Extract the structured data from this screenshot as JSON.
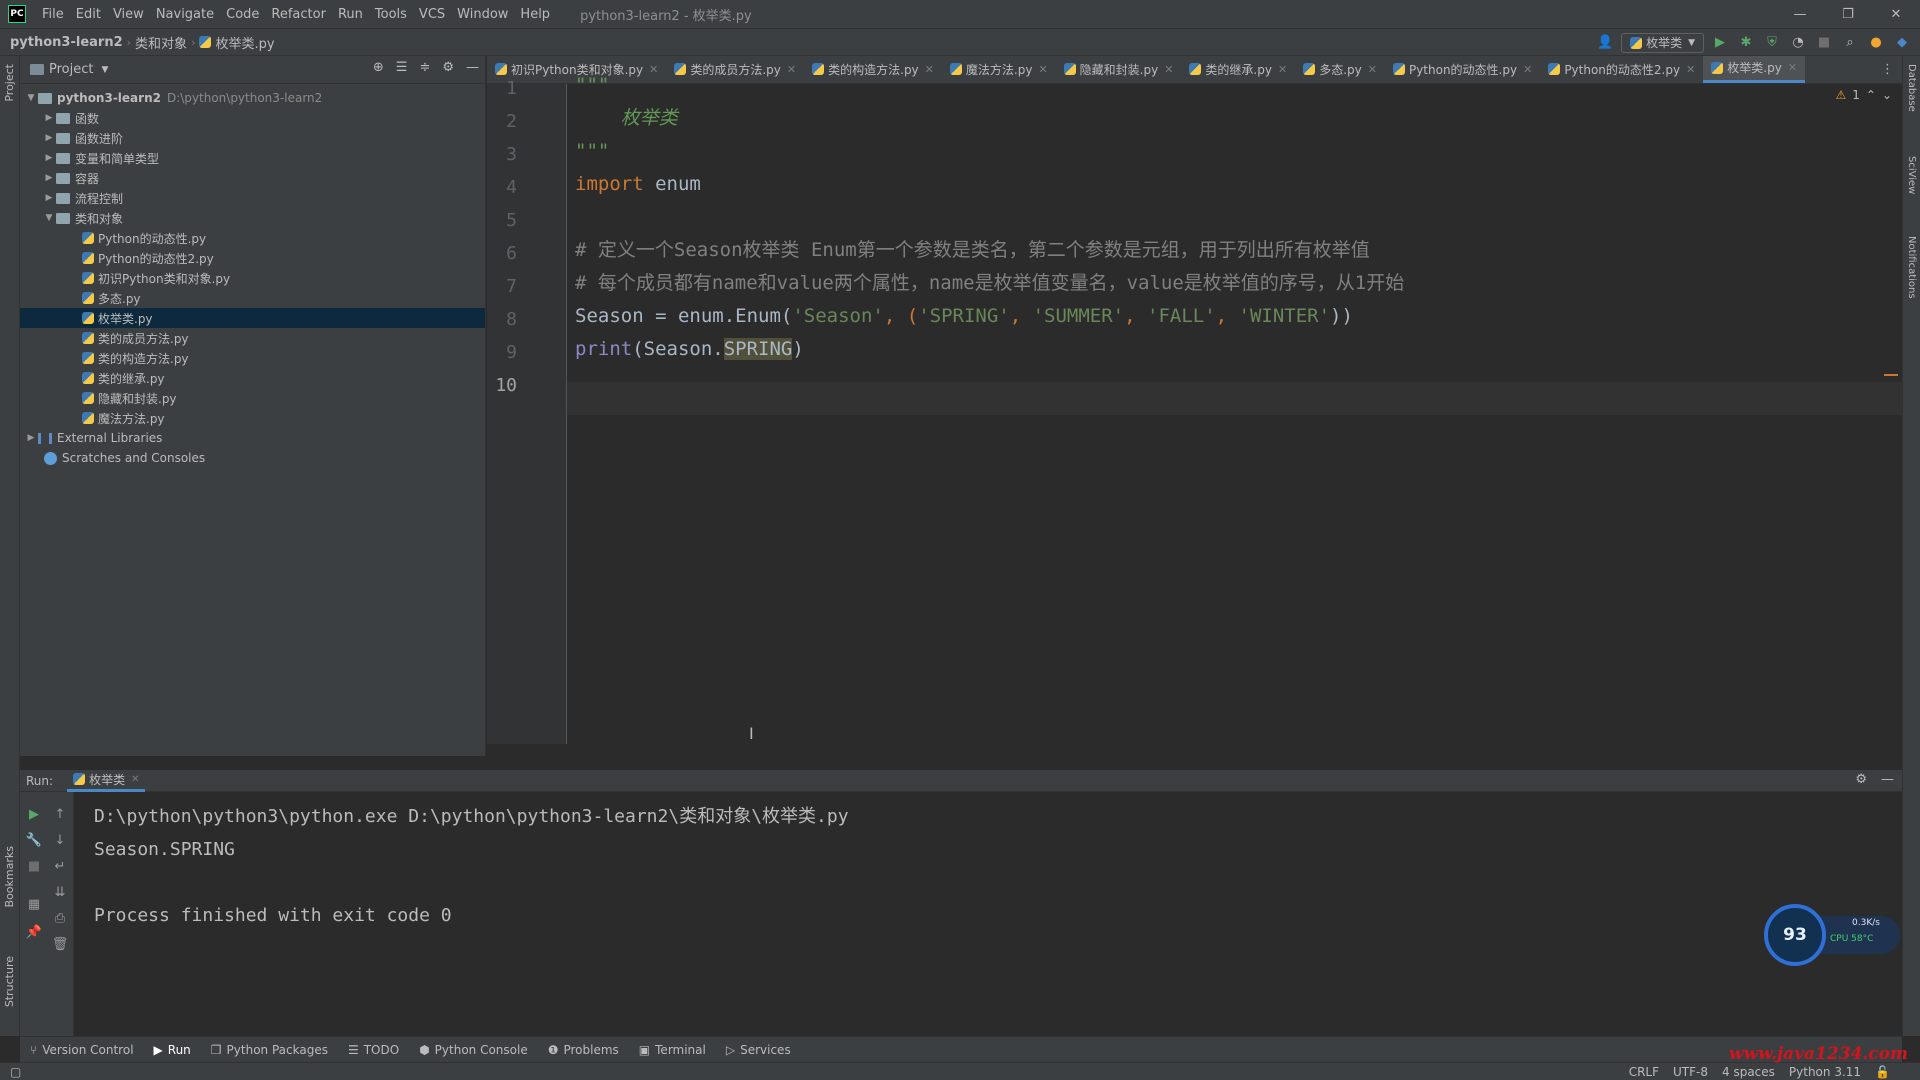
{
  "menubar": {
    "logo": "PC",
    "items": [
      "File",
      "Edit",
      "View",
      "Navigate",
      "Code",
      "Refactor",
      "Run",
      "Tools",
      "VCS",
      "Window",
      "Help"
    ],
    "window_title": "python3-learn2 - 枚举类.py"
  },
  "navbar": {
    "crumbs": [
      "python3-learn2",
      "类和对象",
      "枚举类.py"
    ],
    "run_config": "枚举类"
  },
  "project": {
    "title": "Project",
    "root_name": "python3-learn2",
    "root_path": "D:\\python\\python3-learn2",
    "folders": [
      "函数",
      "函数进阶",
      "变量和简单类型",
      "容器",
      "流程控制"
    ],
    "open_folder": "类和对象",
    "files": [
      "Python的动态性.py",
      "Python的动态性2.py",
      "初识Python类和对象.py",
      "多态.py",
      "枚举类.py",
      "类的成员方法.py",
      "类的构造方法.py",
      "类的继承.py",
      "隐藏和封装.py",
      "魔法方法.py"
    ],
    "external_libraries": "External Libraries",
    "scratches": "Scratches and Consoles"
  },
  "tabs": [
    "初识Python类和对象.py",
    "类的成员方法.py",
    "类的构造方法.py",
    "魔法方法.py",
    "隐藏和封装.py",
    "类的继承.py",
    "多态.py",
    "Python的动态性.py",
    "Python的动态性2.py",
    "枚举类.py"
  ],
  "active_tab": "枚举类.py",
  "editor": {
    "line_numbers": [
      "1",
      "2",
      "3",
      "4",
      "5",
      "6",
      "7",
      "8",
      "9",
      "10"
    ],
    "warnings_count": "1",
    "code": {
      "l1": "\"\"\"",
      "l2": "    枚举类",
      "l3": "\"\"\"",
      "l4_kw": "import",
      "l4_rest": " enum",
      "l6": "# 定义一个Season枚举类 Enum第一个参数是类名，第二个参数是元组，用于列出所有枚举值",
      "l7": "# 每个成员都有name和value两个属性，name是枚举值变量名，value是枚举值的序号，从1开始",
      "l8_a": "Season = enum.Enum(",
      "l8_s1": "'Season'",
      "l8_b": ", (",
      "l8_s2": "'SPRING'",
      "l8_c": ", ",
      "l8_s3": "'SUMMER'",
      "l8_d": ", ",
      "l8_s4": "'FALL'",
      "l8_e": ", ",
      "l8_s5": "'WINTER'",
      "l8_f": "))",
      "l9_fn": "print",
      "l9_a": "(Season.",
      "l9_hl": "SPRING",
      "l9_b": ")"
    }
  },
  "run": {
    "label": "Run:",
    "tab": "枚举类",
    "output": [
      "D:\\python\\python3\\python.exe D:\\python\\python3-learn2\\类和对象\\枚举类.py",
      "Season.SPRING",
      "",
      "Process finished with exit code 0"
    ]
  },
  "cpu_widget": {
    "percent": "93",
    "speed": "0.3K/s",
    "temp": "CPU 58°C"
  },
  "bottom_bar": [
    "Version Control",
    "Run",
    "Python Packages",
    "TODO",
    "Python Console",
    "Problems",
    "Terminal",
    "Services"
  ],
  "status": {
    "line_sep": "CRLF",
    "encoding": "UTF-8",
    "indent": "4 spaces",
    "interpreter": "Python 3.11"
  },
  "side_labels": {
    "project": "Project",
    "bookmarks": "Bookmarks",
    "structure": "Structure",
    "database": "Database",
    "sciview": "SciView",
    "notifications": "Notifications"
  },
  "watermark": "www.java1234.com",
  "colors": {
    "keyword": "#cc7832",
    "string": "#6a8759",
    "comment": "#808080",
    "docstring": "#629755",
    "builtin": "#8888c6",
    "accent": "#4a88c7"
  }
}
